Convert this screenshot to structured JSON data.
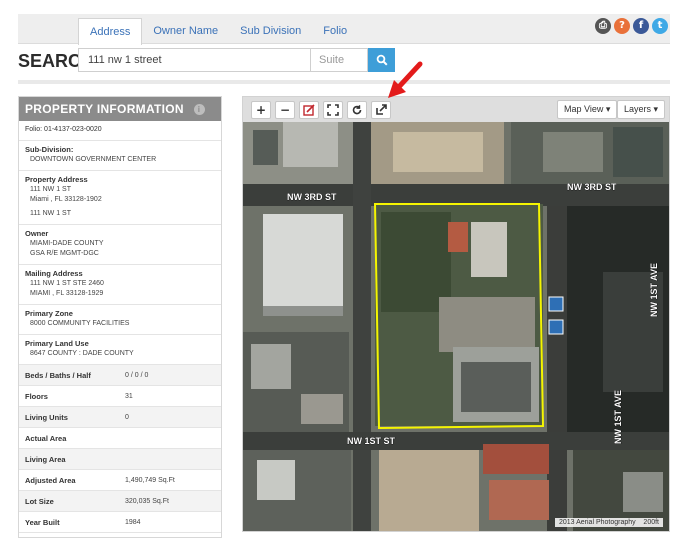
{
  "tabs": [
    {
      "label": "Address",
      "active": true
    },
    {
      "label": "Owner Name",
      "active": false
    },
    {
      "label": "Sub Division",
      "active": false
    },
    {
      "label": "Folio",
      "active": false
    }
  ],
  "share_icons": [
    {
      "name": "print-icon",
      "color": "#555555",
      "glyph": "⎙"
    },
    {
      "name": "help-icon",
      "color": "#e9713a",
      "glyph": "?"
    },
    {
      "name": "facebook-icon",
      "color": "#3b5998",
      "glyph": "f"
    },
    {
      "name": "twitter-icon",
      "color": "#3fa9e6",
      "glyph": "t"
    }
  ],
  "search": {
    "label": "SEARCH:",
    "value": "111 nw 1 street",
    "suite_placeholder": "Suite"
  },
  "property": {
    "title": "PROPERTY INFORMATION",
    "folio": "Folio: 01-4137-023-0020",
    "subdivision_label": "Sub-Division:",
    "subdivision": "DOWNTOWN GOVERNMENT CENTER",
    "address_label": "Property Address",
    "address_lines": [
      "111 NW 1 ST",
      "Miami , FL 33128-1902"
    ],
    "address_extra": "111 NW 1 ST",
    "owner_label": "Owner",
    "owner_lines": [
      "MIAMI-DADE COUNTY",
      "GSA R/E MGMT-DGC"
    ],
    "mailing_label": "Mailing Address",
    "mailing_lines": [
      "111 NW 1 ST STE 2460",
      "MIAMI , FL 33128-1929"
    ],
    "zone_label": "Primary Zone",
    "zone": "8000 COMMUNITY FACILITIES",
    "landuse_label": "Primary Land Use",
    "landuse": "8647 COUNTY : DADE COUNTY",
    "rows": [
      {
        "label": "Beds / Baths / Half",
        "value": "0 / 0 / 0"
      },
      {
        "label": "Floors",
        "value": "31"
      },
      {
        "label": "Living Units",
        "value": "0"
      },
      {
        "label": "Actual Area",
        "value": ""
      },
      {
        "label": "Living Area",
        "value": ""
      },
      {
        "label": "Adjusted Area",
        "value": "1,490,749 Sq.Ft"
      },
      {
        "label": "Lot Size",
        "value": "320,035 Sq.Ft"
      },
      {
        "label": "Year Built",
        "value": "1984"
      }
    ]
  },
  "map": {
    "tools": [
      {
        "name": "zoom-in-button",
        "glyph": "+"
      },
      {
        "name": "zoom-out-button",
        "glyph": "−"
      },
      {
        "name": "draw-tool-button",
        "glyph": "✎"
      },
      {
        "name": "fullscreen-button",
        "glyph": "⛶"
      },
      {
        "name": "refresh-button",
        "glyph": "↻"
      },
      {
        "name": "external-link-button",
        "glyph": "↗"
      }
    ],
    "map_view_label": "Map View",
    "layers_label": "Layers",
    "streets": [
      "NW 3RD ST",
      "NW 3RD ST",
      "NW 1ST AVE",
      "NW 1ST AVE",
      "NW 1ST ST"
    ],
    "attribution": "2013 Aerial Photography",
    "scale": "200ft",
    "highlight_color": "#f5f500",
    "arrow_color": "#e31b1b"
  }
}
